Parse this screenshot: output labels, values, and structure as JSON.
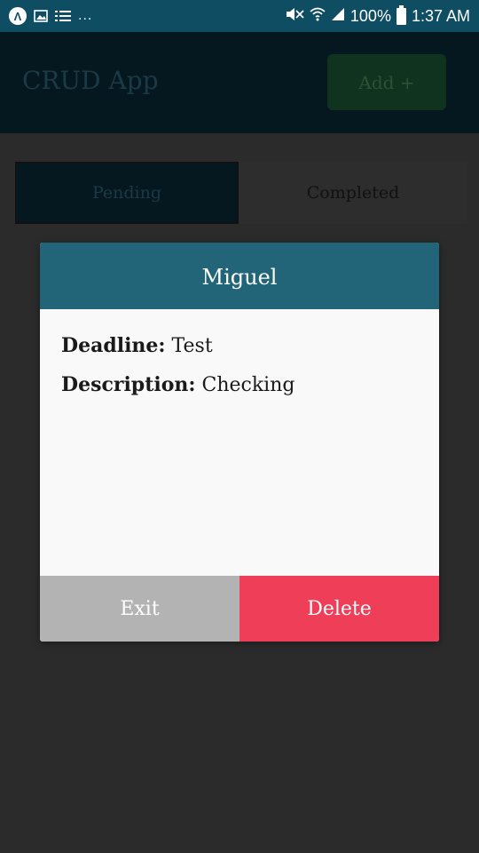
{
  "status_bar": {
    "notification_dots": "...",
    "battery": "100%",
    "time": "1:37 AM",
    "icons": [
      "app-icon",
      "image-icon",
      "list-icon",
      "mute-icon",
      "wifi-icon",
      "signal-icon",
      "battery-icon"
    ]
  },
  "header": {
    "title": "CRUD App",
    "add_label": "Add +"
  },
  "tabs": [
    {
      "label": "Pending",
      "active": true
    },
    {
      "label": "Completed",
      "active": false
    }
  ],
  "modal": {
    "title": "Miguel",
    "fields": [
      {
        "label": "Deadline:",
        "value": "Test"
      },
      {
        "label": "Description:",
        "value": "Checking"
      }
    ],
    "exit_label": "Exit",
    "delete_label": "Delete"
  },
  "colors": {
    "status_bar": "#0f4d63",
    "modal_header": "#226579",
    "delete": "#ef3e58",
    "exit": "#b3b3b3"
  }
}
